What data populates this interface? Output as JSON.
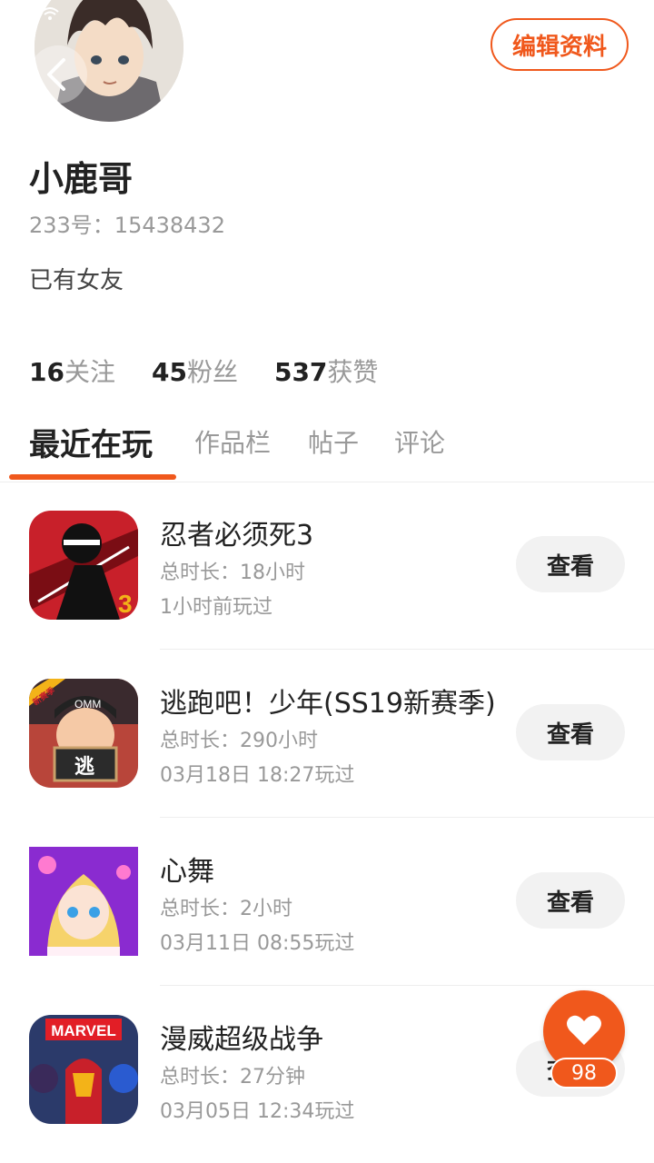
{
  "profile": {
    "name": "小鹿哥",
    "uid_label": "233号：15438432",
    "bio": "已有女友",
    "edit_label": "编辑资料",
    "stats": [
      {
        "num": "16",
        "label": "关注"
      },
      {
        "num": "45",
        "label": "粉丝"
      },
      {
        "num": "537",
        "label": "获赞"
      }
    ]
  },
  "tabs": [
    {
      "label": "最近在玩",
      "active": true
    },
    {
      "label": "作品栏",
      "active": false
    },
    {
      "label": "帖子",
      "active": false
    },
    {
      "label": "评论",
      "active": false
    }
  ],
  "games": [
    {
      "title": "忍者必须死3",
      "duration": "总时长：18小时",
      "last_played": "1小时前玩过",
      "button": "查看"
    },
    {
      "title": "逃跑吧！少年(SS19新赛季)",
      "duration": "总时长：290小时",
      "last_played": "03月18日 18:27玩过",
      "button": "查看"
    },
    {
      "title": "心舞",
      "duration": "总时长：2小时",
      "last_played": "03月11日 08:55玩过",
      "button": "查看"
    },
    {
      "title": "漫威超级战争",
      "duration": "总时长：27分钟",
      "last_played": "03月05日 12:34玩过",
      "button": "查看"
    }
  ],
  "game_icon_text": {
    "ninja_badge": "3",
    "escape_ribbon": "新赛季",
    "escape_cap": "OMM",
    "escape_sign": "逃",
    "marvel": "MARVEL"
  },
  "like": {
    "count": "98"
  },
  "colors": {
    "accent": "#f0581c",
    "button_bg": "#f2f2f2",
    "muted_text": "#999999"
  }
}
